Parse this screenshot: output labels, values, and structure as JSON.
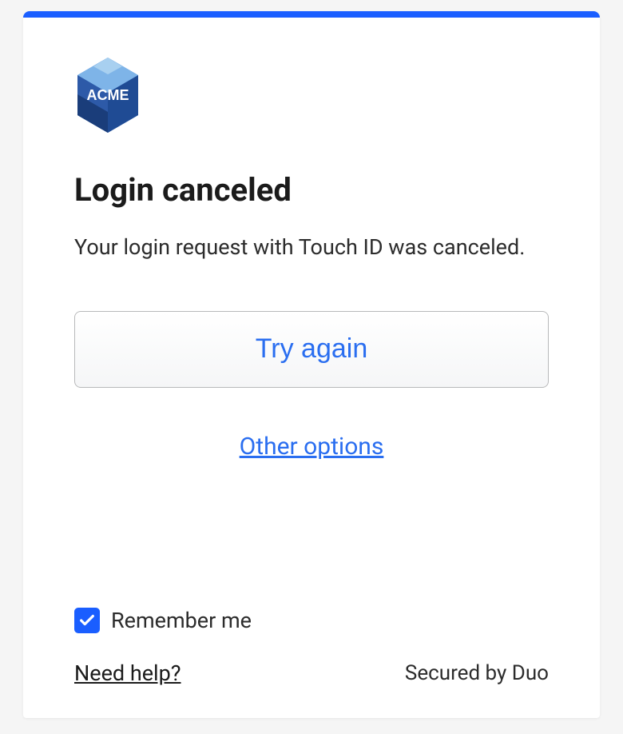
{
  "logo": {
    "text": "ACME"
  },
  "heading": "Login canceled",
  "message": "Your login request with Touch ID was canceled.",
  "try_again_label": "Try again",
  "other_options_label": "Other options",
  "remember": {
    "checked": true,
    "label": "Remember me"
  },
  "help_label": "Need help?",
  "secured_label": "Secured by Duo",
  "colors": {
    "accent": "#1a5eff",
    "link": "#2a6ef0"
  }
}
